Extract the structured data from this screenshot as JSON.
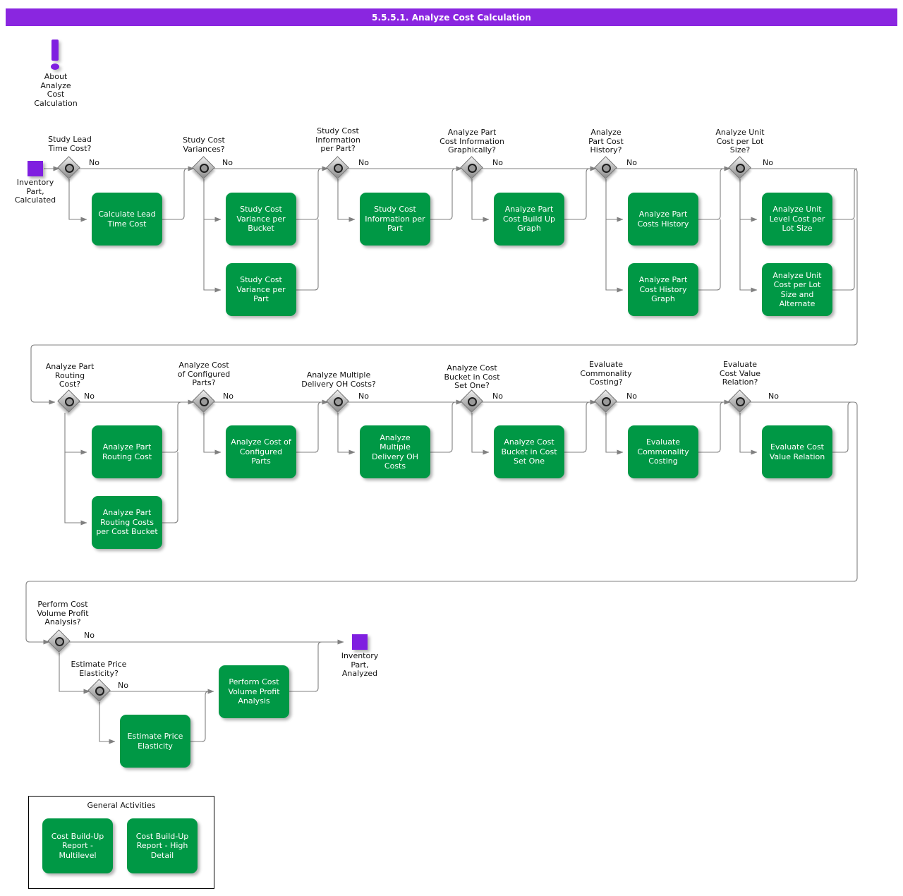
{
  "header": {
    "title": "5.5.5.1. Analyze Cost Calculation"
  },
  "info_marker": {
    "icon": "exclamation-icon",
    "label": "About\nAnalyze\nCost\nCalculation"
  },
  "terminals": [
    {
      "name": "start-terminal",
      "label": "Inventory\nPart,\nCalculated"
    },
    {
      "name": "end-terminal",
      "label": "Inventory\nPart,\nAnalyzed"
    }
  ],
  "edge_label_no": "No",
  "decisions": [
    {
      "id": "d1",
      "label": "Study Lead\nTime Cost?"
    },
    {
      "id": "d2",
      "label": "Study Cost\nVariances?"
    },
    {
      "id": "d3",
      "label": "Study Cost\nInformation\nper Part?"
    },
    {
      "id": "d4",
      "label": "Analyze Part\nCost Information\nGraphically?"
    },
    {
      "id": "d5",
      "label": "Analyze\nPart Cost\nHistory?"
    },
    {
      "id": "d6",
      "label": "Analyze Unit\nCost per Lot\nSize?"
    },
    {
      "id": "d7",
      "label": "Analyze Part\nRouting\nCost?"
    },
    {
      "id": "d8",
      "label": "Analyze Cost\nof Configured\nParts?"
    },
    {
      "id": "d9",
      "label": "Analyze Multiple\nDelivery OH Costs?"
    },
    {
      "id": "d10",
      "label": "Analyze Cost\nBucket in Cost\nSet One?"
    },
    {
      "id": "d11",
      "label": "Evaluate\nCommonality\nCosting?"
    },
    {
      "id": "d12",
      "label": "Evaluate\nCost Value\nRelation?"
    },
    {
      "id": "d13",
      "label": "Perform Cost\nVolume Profit\nAnalysis?"
    },
    {
      "id": "d14",
      "label": "Estimate Price\nElasticity?"
    }
  ],
  "activities": [
    {
      "id": "a1",
      "label": "Calculate Lead Time Cost"
    },
    {
      "id": "a2",
      "label": "Study Cost Variance per Bucket"
    },
    {
      "id": "a3",
      "label": "Study Cost Variance per Part"
    },
    {
      "id": "a4",
      "label": "Study Cost Information per Part"
    },
    {
      "id": "a5",
      "label": "Analyze Part Cost Build Up Graph"
    },
    {
      "id": "a6",
      "label": "Analyze Part Costs History"
    },
    {
      "id": "a7",
      "label": "Analyze Part Cost History Graph"
    },
    {
      "id": "a8",
      "label": "Analyze Unit Level Cost per Lot Size"
    },
    {
      "id": "a9",
      "label": "Analyze Unit Cost per Lot Size and Alternate"
    },
    {
      "id": "a10",
      "label": "Analyze Part Routing Cost"
    },
    {
      "id": "a11",
      "label": "Analyze Part Routing Costs per Cost Bucket"
    },
    {
      "id": "a12",
      "label": "Analyze Cost of Configured Parts"
    },
    {
      "id": "a13",
      "label": "Analyze Multiple Delivery OH Costs"
    },
    {
      "id": "a14",
      "label": "Analyze Cost Bucket in Cost Set One"
    },
    {
      "id": "a15",
      "label": "Evaluate Commonality Costing"
    },
    {
      "id": "a16",
      "label": "Evaluate Cost Value Relation"
    },
    {
      "id": "a17",
      "label": "Perform Cost Volume Profit Analysis"
    },
    {
      "id": "a18",
      "label": "Estimate Price Elasticity"
    }
  ],
  "general_activities": {
    "title": "General Activities",
    "items": [
      {
        "id": "g1",
        "label": "Cost Build-Up Report - Multilevel"
      },
      {
        "id": "g2",
        "label": "Cost Build-Up Report - High Detail"
      }
    ]
  },
  "colors": {
    "header_purple": "#8A26E0",
    "terminal_purple": "#7F1FE0",
    "activity_green": "#009845",
    "line_gray": "#808080",
    "text_dark": "#111111"
  }
}
